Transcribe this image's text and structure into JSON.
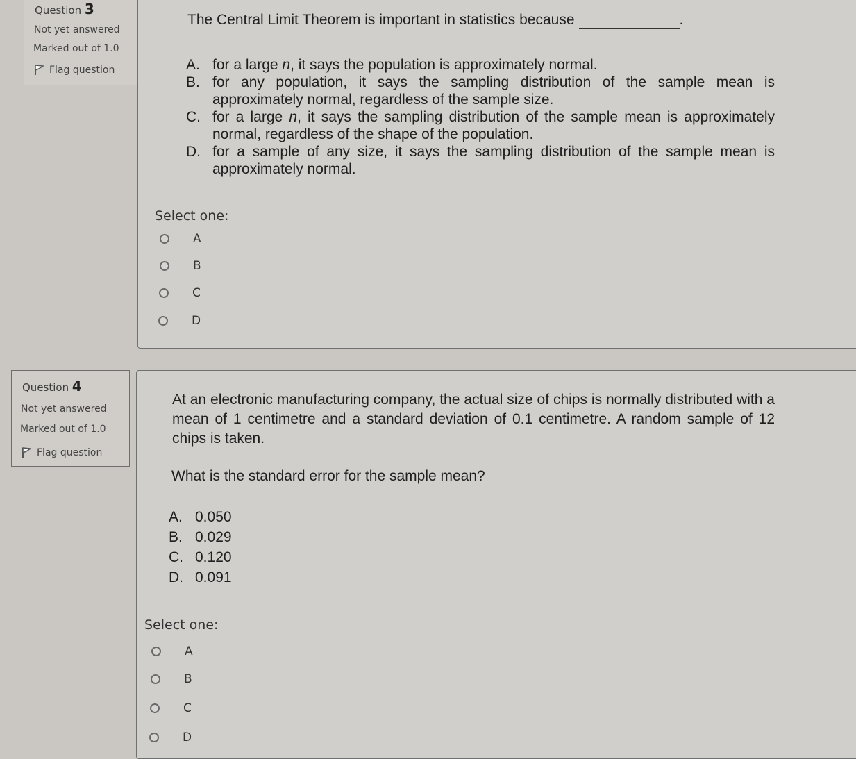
{
  "questions": [
    {
      "info": {
        "question_word": "Question",
        "number": "3",
        "status": "Not yet answered",
        "marks": "Marked out of 1.0",
        "flag_label": "Flag question",
        "flag_icon": "flag-icon"
      },
      "text": "The Central Limit Theorem is important in statistics because",
      "text_suffix": ".",
      "choices": [
        {
          "letter": "A.",
          "text": "for a large n, it says the population is approximately normal."
        },
        {
          "letter": "B.",
          "text": "for any population, it says the sampling distribution of the sample mean is approximately normal, regardless of the sample size."
        },
        {
          "letter": "C.",
          "text": "for a large n, it says the sampling distribution of the sample mean is approximately normal, regardless of the shape of the population."
        },
        {
          "letter": "D.",
          "text": "for a sample of any size, it says the sampling distribution of the sample mean is approximately normal."
        }
      ],
      "select_label": "Select one:",
      "options": [
        {
          "label": "A",
          "selected": false
        },
        {
          "label": "B",
          "selected": false
        },
        {
          "label": "C",
          "selected": false
        },
        {
          "label": "D",
          "selected": false
        }
      ]
    },
    {
      "info": {
        "question_word": "Question",
        "number": "4",
        "status": "Not yet answered",
        "marks": "Marked out of 1.0",
        "flag_label": "Flag question",
        "flag_icon": "flag-icon"
      },
      "text": "At an electronic manufacturing company, the actual size of chips is normally distributed with a mean of 1 centimetre and a standard deviation of 0.1 centimetre. A random sample of 12 chips is taken.",
      "prompt": "What is the standard error for the sample mean?",
      "choices": [
        {
          "letter": "A.",
          "text": "0.050"
        },
        {
          "letter": "B.",
          "text": "0.029"
        },
        {
          "letter": "C.",
          "text": "0.120"
        },
        {
          "letter": "D.",
          "text": "0.091"
        }
      ],
      "select_label": "Select one:",
      "options": [
        {
          "label": "A",
          "selected": false
        },
        {
          "label": "B",
          "selected": false
        },
        {
          "label": "C",
          "selected": false
        },
        {
          "label": "D",
          "selected": false
        }
      ]
    }
  ],
  "colors": {
    "page_bg": "#cac7c3",
    "top_bar": "#0a2a2c"
  }
}
